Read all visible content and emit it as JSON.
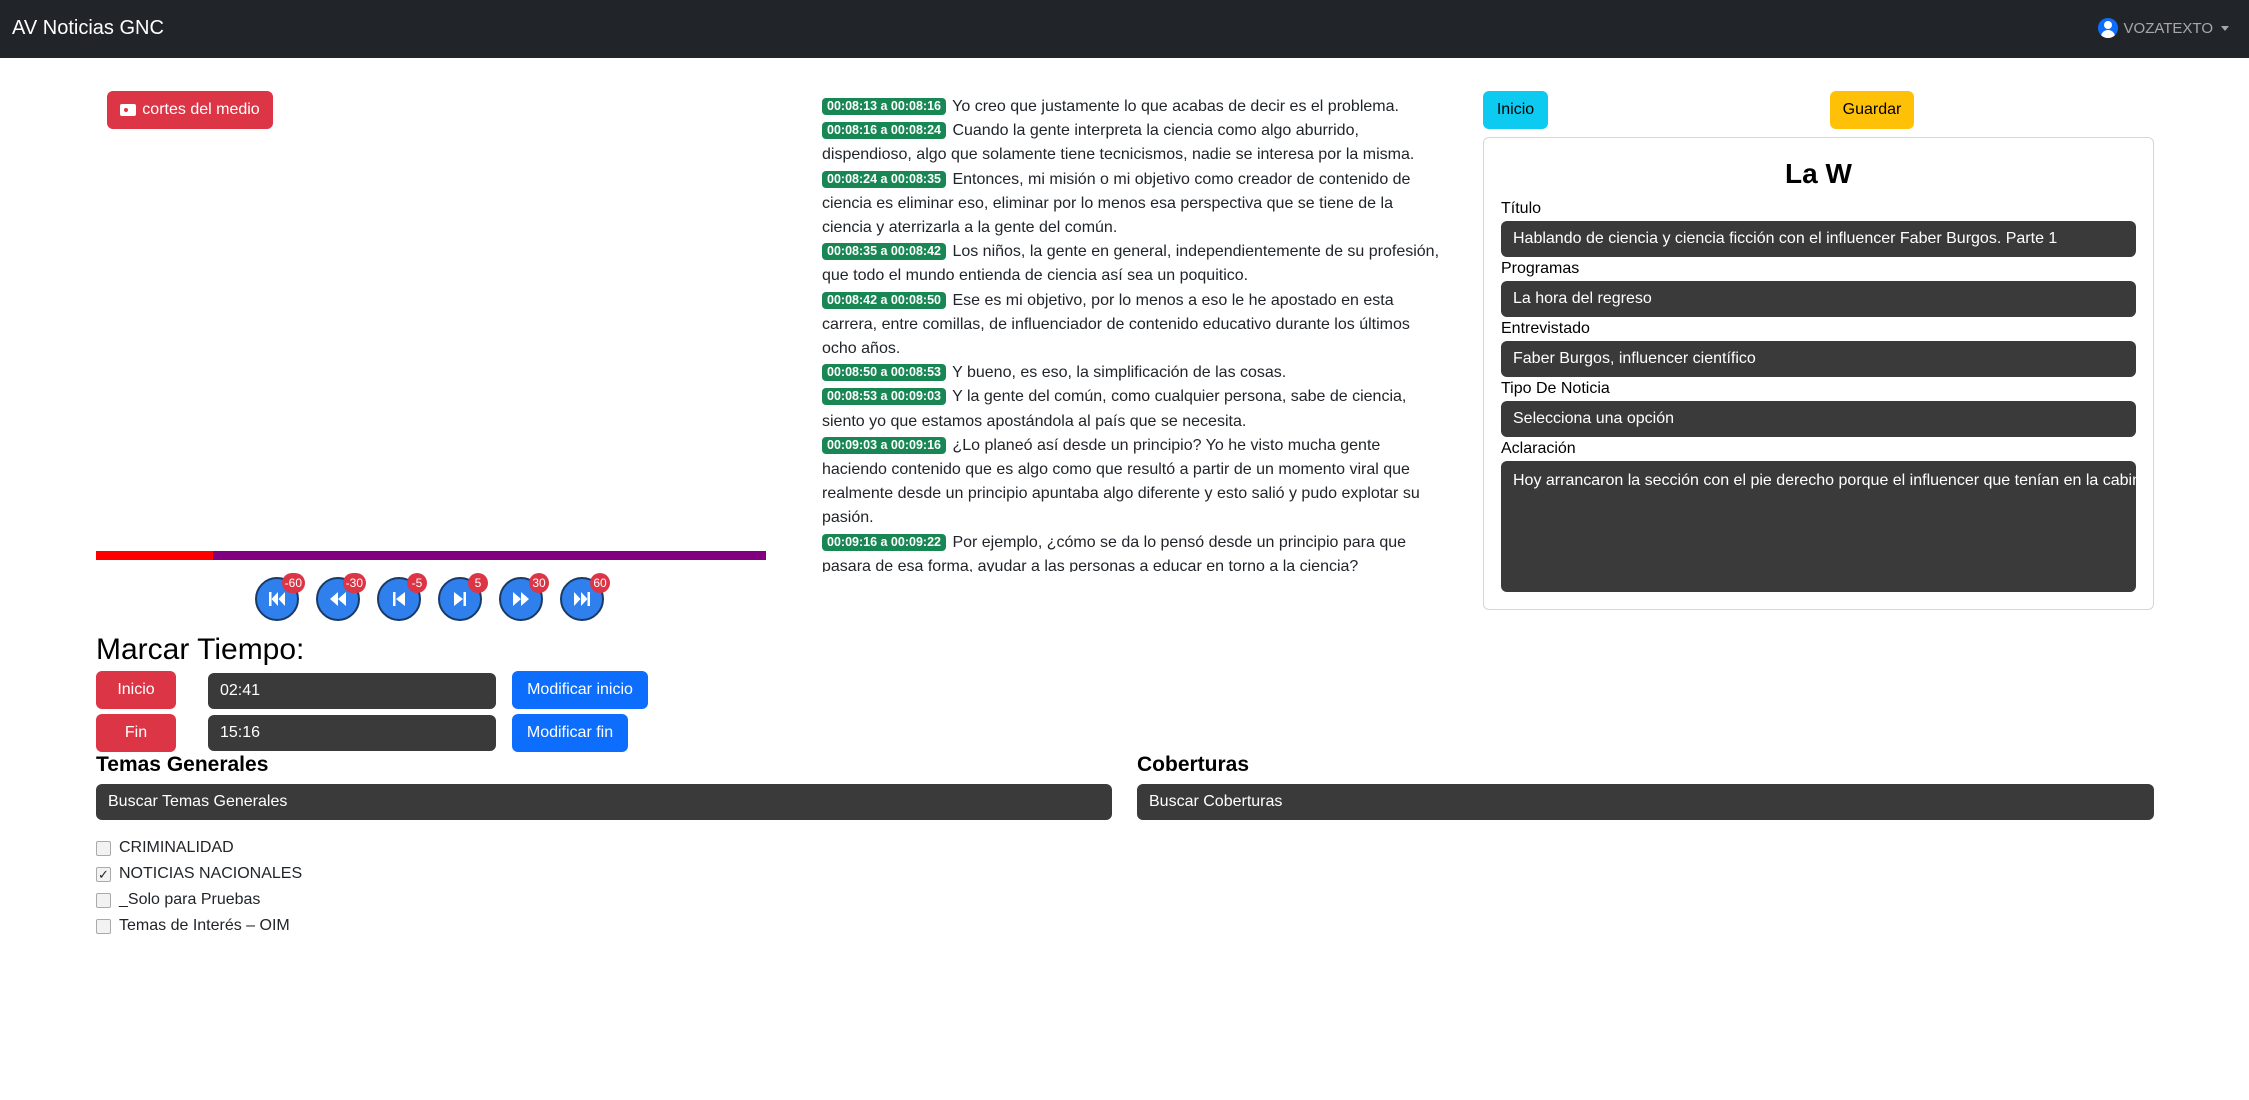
{
  "navbar": {
    "brand": "AV Noticias GNC",
    "user": "VOZATEXTO"
  },
  "player": {
    "cortes_label": "cortes del medio",
    "progress_fraction": 0.175,
    "seek_badges": [
      "-60",
      "-30",
      "-5",
      "5",
      "30",
      "60"
    ]
  },
  "marcar": {
    "title": "Marcar Tiempo:",
    "inicio_label": "Inicio",
    "inicio_value": "02:41",
    "modificar_inicio": "Modificar inicio",
    "fin_label": "Fin",
    "fin_value": "15:16",
    "modificar_fin": "Modificar fin"
  },
  "temas": {
    "title": "Temas Generales",
    "placeholder": "Buscar Temas Generales",
    "items": [
      {
        "label": "CRIMINALIDAD",
        "checked": false
      },
      {
        "label": "NOTICIAS NACIONALES",
        "checked": true
      },
      {
        "label": "_Solo para Pruebas",
        "checked": false
      },
      {
        "label": "Temas de Interés – OIM",
        "checked": false
      }
    ]
  },
  "coberturas": {
    "title": "Coberturas",
    "placeholder": "Buscar Coberturas"
  },
  "transcript": [
    {
      "time": "00:08:13 a 00:08:16",
      "text": "Yo creo que justamente lo que acabas de decir es el problema."
    },
    {
      "time": "00:08:16 a 00:08:24",
      "text": "Cuando la gente interpreta la ciencia como algo aburrido, dispendioso, algo que solamente tiene tecnicismos, nadie se interesa por la misma."
    },
    {
      "time": "00:08:24 a 00:08:35",
      "text": "Entonces, mi misión o mi objetivo como creador de contenido de ciencia es eliminar eso, eliminar por lo menos esa perspectiva que se tiene de la ciencia y aterrizarla a la gente del común."
    },
    {
      "time": "00:08:35 a 00:08:42",
      "text": "Los niños, la gente en general, independientemente de su profesión, que todo el mundo entienda de ciencia así sea un poquitico."
    },
    {
      "time": "00:08:42 a 00:08:50",
      "text": "Ese es mi objetivo, por lo menos a eso le he apostado en esta carrera, entre comillas, de influenciador de contenido educativo durante los últimos ocho años."
    },
    {
      "time": "00:08:50 a 00:08:53",
      "text": "Y bueno, es eso, la simplificación de las cosas."
    },
    {
      "time": "00:08:53 a 00:09:03",
      "text": "Y la gente del común, como cualquier persona, sabe de ciencia, siento yo que estamos apostándola al país que se necesita."
    },
    {
      "time": "00:09:03 a 00:09:16",
      "text": "¿Lo planeó así desde un principio? Yo he visto mucha gente haciendo contenido que es algo como que resultó a partir de un momento viral que realmente desde un principio apuntaba algo diferente y esto salió y pudo explotar su pasión."
    },
    {
      "time": "00:09:16 a 00:09:22",
      "text": "Por ejemplo, ¿cómo se da lo pensó desde un principio para que pasara de esa forma, ayudar a las personas a educar en torno a la ciencia?"
    }
  ],
  "actions": {
    "inicio": "Inicio",
    "guardar": "Guardar"
  },
  "card": {
    "title": "La W",
    "titulo_label": "Título",
    "titulo_value": "Hablando de ciencia y ciencia ficción con el influencer Faber Burgos. Parte 1",
    "programas_label": "Programas",
    "programas_value": "La hora del regreso",
    "entrevistado_label": "Entrevistado",
    "entrevistado_value": "Faber Burgos, influencer científico",
    "tipo_label": "Tipo De Noticia",
    "tipo_value": "Selecciona una opción",
    "aclaracion_label": "Aclaración",
    "aclaracion_value": "Hoy arrancaron la sección con el pie derecho porque el influencer que tenían en la cabina"
  },
  "colors": {
    "navbar": "#212529",
    "danger": "#dc3545",
    "primary": "#0d6efd",
    "success": "#198754",
    "info": "#0dcaf0",
    "warning": "#ffc107",
    "progress_played": "#ff0000",
    "progress_rest": "#800080"
  }
}
